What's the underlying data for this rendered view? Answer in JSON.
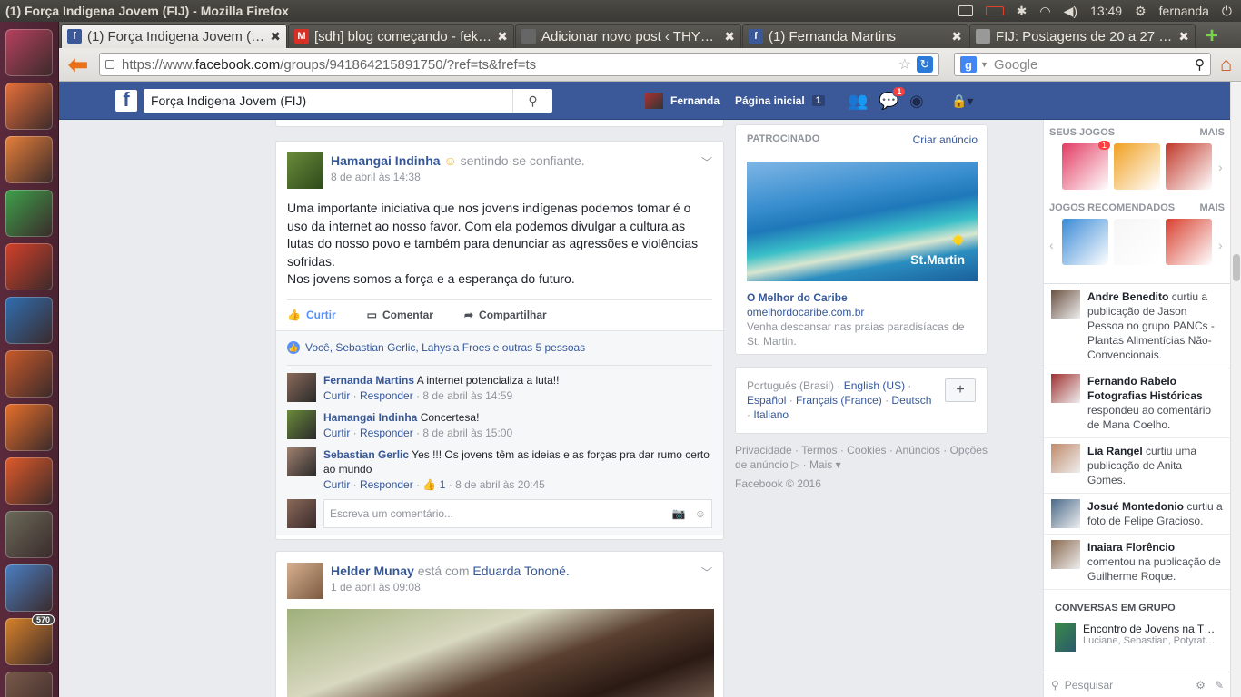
{
  "window_title": "(1) Força Indigena Jovem (FIJ) - Mozilla Firefox",
  "tray": {
    "time": "13:49",
    "user": "fernanda"
  },
  "launcher": [
    {
      "name": "ubuntu-dash-icon",
      "color": "#b7415f"
    },
    {
      "name": "files-icon",
      "color": "#e8703a"
    },
    {
      "name": "firefox-icon",
      "color": "#e8803a"
    },
    {
      "name": "calc-icon",
      "color": "#3ea14b"
    },
    {
      "name": "settings-icon",
      "color": "#d5402a"
    },
    {
      "name": "writer-icon",
      "color": "#2f6fb3"
    },
    {
      "name": "impress-icon",
      "color": "#c95a2a"
    },
    {
      "name": "store-icon",
      "color": "#e8702a"
    },
    {
      "name": "ubuntu-one-icon",
      "color": "#e05a2a"
    },
    {
      "name": "gimp-icon",
      "color": "#6b6b5a"
    },
    {
      "name": "chromium-icon",
      "color": "#4a7fc4"
    },
    {
      "name": "update-icon",
      "color": "#d8822a",
      "badge": "570"
    },
    {
      "name": "trash-icon",
      "color": "#7a5a4a"
    }
  ],
  "tabs": [
    {
      "label": "(1) Força Indigena Jovem (FIJ)",
      "fav": "f",
      "fav_color": "#3b5998",
      "active": true
    },
    {
      "label": "[sdh] blog começando - fek…",
      "fav": "M",
      "fav_color": "#d93025",
      "active": false
    },
    {
      "label": "Adicionar novo post ‹ THYD…",
      "fav": "",
      "fav_color": "#666",
      "active": false
    },
    {
      "label": "(1) Fernanda Martins",
      "fav": "f",
      "fav_color": "#3b5998",
      "active": false
    },
    {
      "label": "FIJ: Postagens de 20 a 27 de…",
      "fav": "",
      "fav_color": "#999",
      "active": false
    }
  ],
  "url": {
    "prefix": "https://www.",
    "domain": "facebook.com",
    "path": "/groups/941864215891750/?ref=ts&fref=ts"
  },
  "search_engine": {
    "placeholder": "Google"
  },
  "fb": {
    "search_value": "Força Indigena Jovem (FIJ)",
    "user": "Fernanda",
    "home": "Página inicial",
    "home_count": "1",
    "msg_badge": "1"
  },
  "post1": {
    "author": "Hamangai Indinha",
    "feeling": "sentindo-se confiante.",
    "time": "8 de abril às 14:38",
    "text": [
      "Uma importante iniciativa que nos jovens indígenas podemos tomar é o",
      "uso da internet ao nosso favor. Com ela podemos divulgar a cultura,as",
      "lutas do nosso povo e também para denunciar as agressões e violências",
      "sofridas.",
      "Nos jovens somos a força e a esperança do futuro."
    ],
    "actions": {
      "like": "Curtir",
      "comment": "Comentar",
      "share": "Compartilhar"
    },
    "likes": "Você, Sebastian Gerlic, Lahysla Froes e outras 5 pessoas",
    "comments": [
      {
        "name": "Fernanda Martins",
        "text": "A internet potencializa a luta!!",
        "like": "Curtir",
        "reply": "Responder",
        "count": "",
        "time": "8 de abril às 14:59",
        "color": "#8a6a5a"
      },
      {
        "name": "Hamangai Indinha",
        "text": "Concertesa!",
        "like": "Curtir",
        "reply": "Responder",
        "count": "",
        "time": "8 de abril às 15:00",
        "color": "#6a8a3a"
      },
      {
        "name": "Sebastian Gerlic",
        "text": "Yes !!! Os jovens têm as ideias e as forças pra dar rumo certo ao mundo",
        "like": "Curtir",
        "reply": "Responder",
        "count": "1",
        "time": "8 de abril às 20:45",
        "color": "#a08070"
      }
    ],
    "write_placeholder": "Escreva um comentário..."
  },
  "post2": {
    "author": "Helder Munay",
    "with_prefix": "está com",
    "with_name": "Eduarda Tononé.",
    "time": "1 de abril às 09:08"
  },
  "ad": {
    "header": "PATROCINADO",
    "create": "Criar anúncio",
    "image_text": "St.Martin",
    "title": "O Melhor do Caribe",
    "domain": "omelhordocaribe.com.br",
    "desc": "Venha descansar nas praias paradisíacas de St. Martin."
  },
  "languages": {
    "current": "Português (Brasil)",
    "links": [
      "English (US)",
      "Español",
      "Français (France)",
      "Deutsch",
      "Italiano"
    ]
  },
  "footer": {
    "links": [
      "Privacidade",
      "Termos",
      "Cookies",
      "Anúncios",
      "Opções de anúncio",
      "Mais"
    ],
    "copyright": "Facebook © 2016"
  },
  "sidebar": {
    "games_header": "SEUS JOGOS",
    "more": "MAIS",
    "games": [
      {
        "name": "candy-crush",
        "color": "#e23b62",
        "badge": "1"
      },
      {
        "name": "frog-game",
        "color": "#f0a020",
        "badge": ""
      },
      {
        "name": "millionaire-city",
        "color": "#c0392b",
        "badge": ""
      }
    ],
    "rec_header": "JOGOS RECOMENDADOS",
    "rec_games": [
      {
        "name": "frozen",
        "color": "#3a8ad6",
        "badge": ""
      },
      {
        "name": "clock-game",
        "color": "#f6f6f6",
        "badge": ""
      },
      {
        "name": "angry-birds-friends",
        "color": "#d84030",
        "badge": ""
      }
    ],
    "ticker": [
      {
        "name": "Andre Benedito",
        "text": "curtiu a publicação de Jason Pessoa no grupo PANCs - Plantas Alimentícias Não-Convencionais.",
        "color": "#6a5040"
      },
      {
        "name": "Fernando Rabelo Fotografias Históricas",
        "text": "respondeu ao comentário de Mana Coelho.",
        "color": "#a03030"
      },
      {
        "name": "Lia Rangel",
        "text": "curtiu uma publicação de Anita Gomes.",
        "color": "#c08a6a"
      },
      {
        "name": "Josué Montedonio",
        "text": "curtiu a foto de Felipe Gracioso.",
        "color": "#4a6a8a"
      },
      {
        "name": "Inaiara Florêncio",
        "text": "comentou na publicação de Guilherme Roque.",
        "color": "#8a6a50"
      }
    ],
    "chat_header": "CONVERSAS EM GRUPO",
    "chat": {
      "name": "Encontro de Jovens na T…",
      "members": "Luciane, Sebastian, Potyratê, …"
    },
    "chat_search": "Pesquisar"
  }
}
